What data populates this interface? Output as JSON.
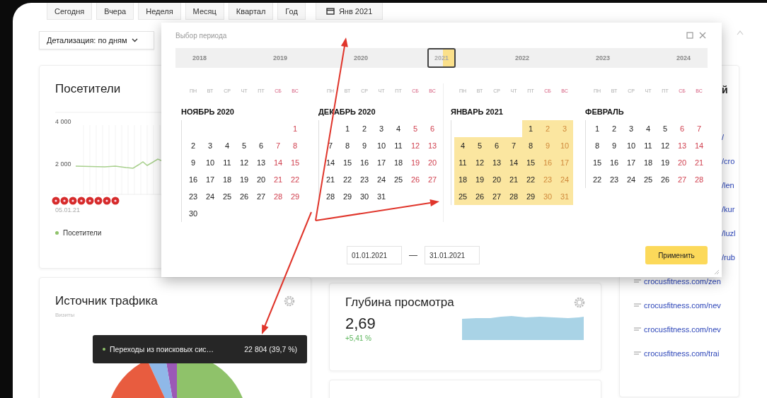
{
  "toolbar": {
    "periods": [
      {
        "label": "Сегодня",
        "selected": false
      },
      {
        "label": "Вчера",
        "selected": false
      },
      {
        "label": "Неделя",
        "selected": false
      },
      {
        "label": "Месяц",
        "selected": false
      },
      {
        "label": "Квартал",
        "selected": false
      },
      {
        "label": "Год",
        "selected": false
      }
    ],
    "date_button": {
      "label": "Янв 2021"
    }
  },
  "detail_dropdown": {
    "label": "Детализация: по дням"
  },
  "visitors_card": {
    "title": "Посетители",
    "y_labels": [
      "4 000",
      "2 000"
    ],
    "date_label": "05.01.21",
    "legend": "Посетители"
  },
  "traffic_card": {
    "title": "Источник трафика",
    "subtitle": "Визиты",
    "tooltip": {
      "label": "Переходы из поисковых сис…",
      "value": "22 804 (39,7 %)"
    }
  },
  "depth_card": {
    "title": "Глубина просмотра",
    "value": "2,69",
    "change": "+5,41 %"
  },
  "right_panel": {
    "heading_fragment": "й",
    "links": [
      {
        "text": "/",
        "kind": "clipped"
      },
      {
        "text": "/cro",
        "kind": "clipped"
      },
      {
        "text": "/len",
        "kind": "clipped"
      },
      {
        "text": "/kur",
        "kind": "clipped"
      },
      {
        "text": "/luzl",
        "kind": "clipped"
      },
      {
        "text": "/rub",
        "kind": "clipped"
      },
      {
        "text": "crocusfitness.com/zen",
        "kind": "full"
      },
      {
        "text": "crocusfitness.com/nev",
        "kind": "full"
      },
      {
        "text": "crocusfitness.com/nev",
        "kind": "full"
      },
      {
        "text": "crocusfitness.com/trai",
        "kind": "full"
      }
    ]
  },
  "period_popup": {
    "title": "Выбор периода",
    "years": [
      {
        "label": "2018",
        "selected": false
      },
      {
        "label": "2019",
        "selected": false
      },
      {
        "label": "2020",
        "selected": false
      },
      {
        "label": "2021",
        "selected": true
      },
      {
        "label": "2022",
        "selected": false
      },
      {
        "label": "2023",
        "selected": false
      },
      {
        "label": "2024",
        "selected": false
      }
    ],
    "months": [
      {
        "title": "НОЯБРЬ 2020",
        "selected": false,
        "weekdays": [
          "ПН",
          "ВТ",
          "СР",
          "ЧТ",
          "ПТ",
          "СБ",
          "ВС"
        ],
        "weeks": [
          [
            "1"
          ],
          [
            "2",
            "3",
            "4",
            "5",
            "6",
            "7",
            "8"
          ],
          [
            "9",
            "10",
            "11",
            "12",
            "13",
            "14",
            "15"
          ],
          [
            "16",
            "17",
            "18",
            "19",
            "20",
            "21",
            "22"
          ],
          [
            "23",
            "24",
            "25",
            "26",
            "27",
            "28",
            "29"
          ],
          [
            "30"
          ]
        ]
      },
      {
        "title": "ДЕКАБРЬ 2020",
        "selected": false,
        "weekdays": [
          "ПН",
          "ВТ",
          "СР",
          "ЧТ",
          "ПТ",
          "СБ",
          "ВС"
        ],
        "weeks": [
          [
            "1",
            "2",
            "3",
            "4",
            "5",
            "6"
          ],
          [
            "7",
            "8",
            "9",
            "10",
            "11",
            "12",
            "13"
          ],
          [
            "14",
            "15",
            "16",
            "17",
            "18",
            "19",
            "20"
          ],
          [
            "21",
            "22",
            "23",
            "24",
            "25",
            "26",
            "27"
          ],
          [
            "28",
            "29",
            "30",
            "31"
          ]
        ]
      },
      {
        "title": "ЯНВАРЬ 2021",
        "selected": true,
        "weekdays": [
          "ПН",
          "ВТ",
          "СР",
          "ЧТ",
          "ПТ",
          "СБ",
          "ВС"
        ],
        "weeks": [
          [
            "1",
            "2",
            "3"
          ],
          [
            "4",
            "5",
            "6",
            "7",
            "8",
            "9",
            "10"
          ],
          [
            "11",
            "12",
            "13",
            "14",
            "15",
            "16",
            "17"
          ],
          [
            "18",
            "19",
            "20",
            "21",
            "22",
            "23",
            "24"
          ],
          [
            "25",
            "26",
            "27",
            "28",
            "29",
            "30",
            "31"
          ]
        ]
      },
      {
        "title": "ФЕВРАЛЬ",
        "selected": false,
        "weekdays": [
          "ПН",
          "ВТ",
          "СР",
          "ЧТ",
          "ПТ",
          "СБ",
          "ВС"
        ],
        "weeks": [
          [
            "1",
            "2",
            "3",
            "4",
            "5",
            "6",
            "7"
          ],
          [
            "8",
            "9",
            "10",
            "11",
            "12",
            "13",
            "14"
          ],
          [
            "15",
            "16",
            "17",
            "18",
            "19",
            "20",
            "21"
          ],
          [
            "22",
            "23",
            "24",
            "25",
            "26",
            "27",
            "28"
          ]
        ]
      }
    ],
    "date_from": "01.01.2021",
    "date_separator": "—",
    "date_to": "31.01.2021",
    "apply_button": "Применить"
  }
}
